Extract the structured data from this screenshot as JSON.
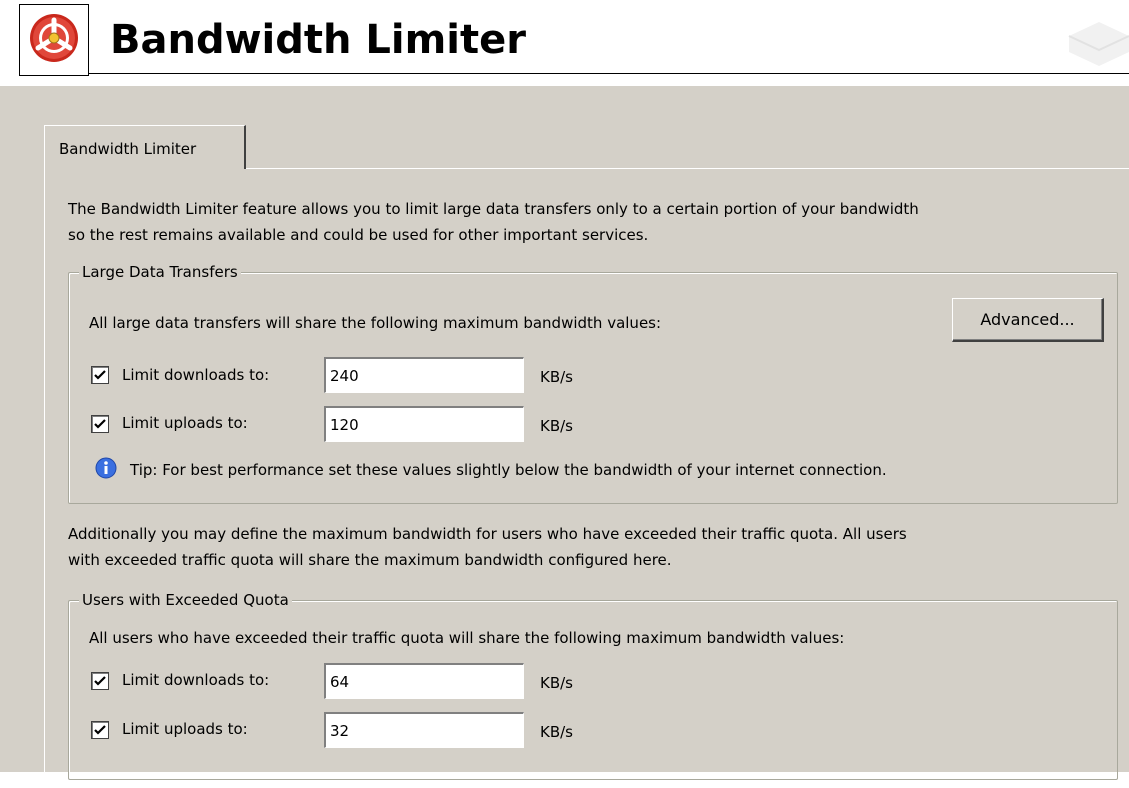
{
  "header": {
    "title": "Bandwidth Limiter",
    "logo_icon": "red-valve-wheel-icon"
  },
  "tab": {
    "label": "Bandwidth Limiter"
  },
  "intro": {
    "line1": "The Bandwidth Limiter feature allows you to limit large data transfers only to a certain portion of your bandwidth",
    "line2": "so the rest remains available and could be used for other important services."
  },
  "large_transfers": {
    "legend": "Large Data Transfers",
    "description": "All large data transfers will share the following maximum bandwidth values:",
    "advanced_button": "Advanced...",
    "download_label": "Limit downloads to:",
    "download_value": "240",
    "download_checked": true,
    "upload_label": "Limit uploads to:",
    "upload_value": "120",
    "upload_checked": true,
    "unit": "KB/s",
    "tip": "Tip: For best performance set these values slightly below the bandwidth of your internet connection."
  },
  "additional": {
    "line1": "Additionally you may define the maximum bandwidth for users who have exceeded their traffic quota. All users",
    "line2": "with exceeded traffic quota will share the maximum bandwidth configured here."
  },
  "quota": {
    "legend": "Users with Exceeded Quota",
    "description": "All users who have exceeded their traffic quota will share the following maximum bandwidth values:",
    "download_label": "Limit downloads to:",
    "download_value": "64",
    "download_checked": true,
    "upload_label": "Limit uploads to:",
    "upload_value": "32",
    "upload_checked": true,
    "unit": "KB/s"
  },
  "colors": {
    "panel": "#d4d0c8",
    "logo_red": "#d93a2b",
    "info_blue": "#2a5bd7"
  }
}
